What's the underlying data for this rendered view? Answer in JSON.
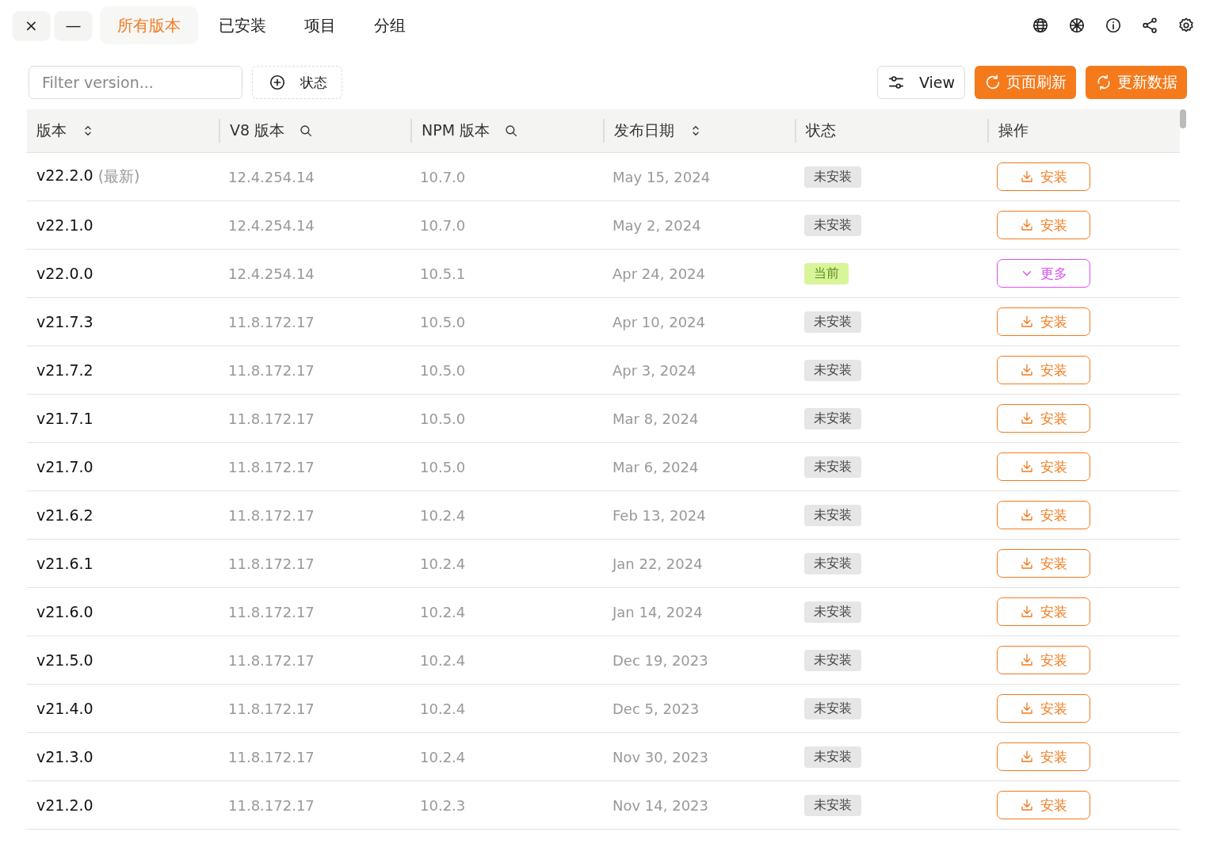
{
  "window_controls": {
    "close": "×",
    "minimize": "—"
  },
  "tabs": [
    {
      "label": "所有版本",
      "selected": true
    },
    {
      "label": "已安装",
      "selected": false
    },
    {
      "label": "项目",
      "selected": false
    },
    {
      "label": "分组",
      "selected": false
    }
  ],
  "toolbar": {
    "filter": {
      "placeholder": "Filter version..."
    },
    "status_filter": "状态",
    "view_button": "View",
    "refresh_button": "页面刷新",
    "update_button": "更新数据"
  },
  "table": {
    "columns": [
      {
        "label": "版本",
        "kind": "sortable"
      },
      {
        "label": "V8 版本",
        "kind": "searchable"
      },
      {
        "label": "NPM 版本",
        "kind": "searchable"
      },
      {
        "label": "发布日期",
        "kind": "sortable"
      },
      {
        "label": "状态",
        "kind": "plain"
      },
      {
        "label": "操作",
        "kind": "plain"
      }
    ],
    "rows": [
      {
        "version": "v22.2.0",
        "tag": "(最新)",
        "v8": "12.4.254.14",
        "npm": "10.7.0",
        "date": "May 15, 2024",
        "status": {
          "kind": "not_installed",
          "label": "未安装"
        },
        "action": {
          "kind": "install",
          "label": "安装"
        }
      },
      {
        "version": "v22.1.0",
        "v8": "12.4.254.14",
        "npm": "10.7.0",
        "date": "May 2, 2024",
        "status": {
          "kind": "not_installed",
          "label": "未安装"
        },
        "action": {
          "kind": "install",
          "label": "安装"
        }
      },
      {
        "version": "v22.0.0",
        "v8": "12.4.254.14",
        "npm": "10.5.1",
        "date": "Apr 24, 2024",
        "status": {
          "kind": "current",
          "label": "当前"
        },
        "action": {
          "kind": "more",
          "label": "更多"
        }
      },
      {
        "version": "v21.7.3",
        "v8": "11.8.172.17",
        "npm": "10.5.0",
        "date": "Apr 10, 2024",
        "status": {
          "kind": "not_installed",
          "label": "未安装"
        },
        "action": {
          "kind": "install",
          "label": "安装"
        }
      },
      {
        "version": "v21.7.2",
        "v8": "11.8.172.17",
        "npm": "10.5.0",
        "date": "Apr 3, 2024",
        "status": {
          "kind": "not_installed",
          "label": "未安装"
        },
        "action": {
          "kind": "install",
          "label": "安装"
        }
      },
      {
        "version": "v21.7.1",
        "v8": "11.8.172.17",
        "npm": "10.5.0",
        "date": "Mar 8, 2024",
        "status": {
          "kind": "not_installed",
          "label": "未安装"
        },
        "action": {
          "kind": "install",
          "label": "安装"
        }
      },
      {
        "version": "v21.7.0",
        "v8": "11.8.172.17",
        "npm": "10.5.0",
        "date": "Mar 6, 2024",
        "status": {
          "kind": "not_installed",
          "label": "未安装"
        },
        "action": {
          "kind": "install",
          "label": "安装"
        }
      },
      {
        "version": "v21.6.2",
        "v8": "11.8.172.17",
        "npm": "10.2.4",
        "date": "Feb 13, 2024",
        "status": {
          "kind": "not_installed",
          "label": "未安装"
        },
        "action": {
          "kind": "install",
          "label": "安装"
        }
      },
      {
        "version": "v21.6.1",
        "v8": "11.8.172.17",
        "npm": "10.2.4",
        "date": "Jan 22, 2024",
        "status": {
          "kind": "not_installed",
          "label": "未安装"
        },
        "action": {
          "kind": "install",
          "label": "安装"
        }
      },
      {
        "version": "v21.6.0",
        "v8": "11.8.172.17",
        "npm": "10.2.4",
        "date": "Jan 14, 2024",
        "status": {
          "kind": "not_installed",
          "label": "未安装"
        },
        "action": {
          "kind": "install",
          "label": "安装"
        }
      },
      {
        "version": "v21.5.0",
        "v8": "11.8.172.17",
        "npm": "10.2.4",
        "date": "Dec 19, 2023",
        "status": {
          "kind": "not_installed",
          "label": "未安装"
        },
        "action": {
          "kind": "install",
          "label": "安装"
        }
      },
      {
        "version": "v21.4.0",
        "v8": "11.8.172.17",
        "npm": "10.2.4",
        "date": "Dec 5, 2023",
        "status": {
          "kind": "not_installed",
          "label": "未安装"
        },
        "action": {
          "kind": "install",
          "label": "安装"
        }
      },
      {
        "version": "v21.3.0",
        "v8": "11.8.172.17",
        "npm": "10.2.4",
        "date": "Nov 30, 2023",
        "status": {
          "kind": "not_installed",
          "label": "未安装"
        },
        "action": {
          "kind": "install",
          "label": "安装"
        }
      },
      {
        "version": "v21.2.0",
        "v8": "11.8.172.17",
        "npm": "10.2.3",
        "date": "Nov 14, 2023",
        "status": {
          "kind": "not_installed",
          "label": "未安装"
        },
        "action": {
          "kind": "install",
          "label": "安装"
        }
      }
    ]
  }
}
